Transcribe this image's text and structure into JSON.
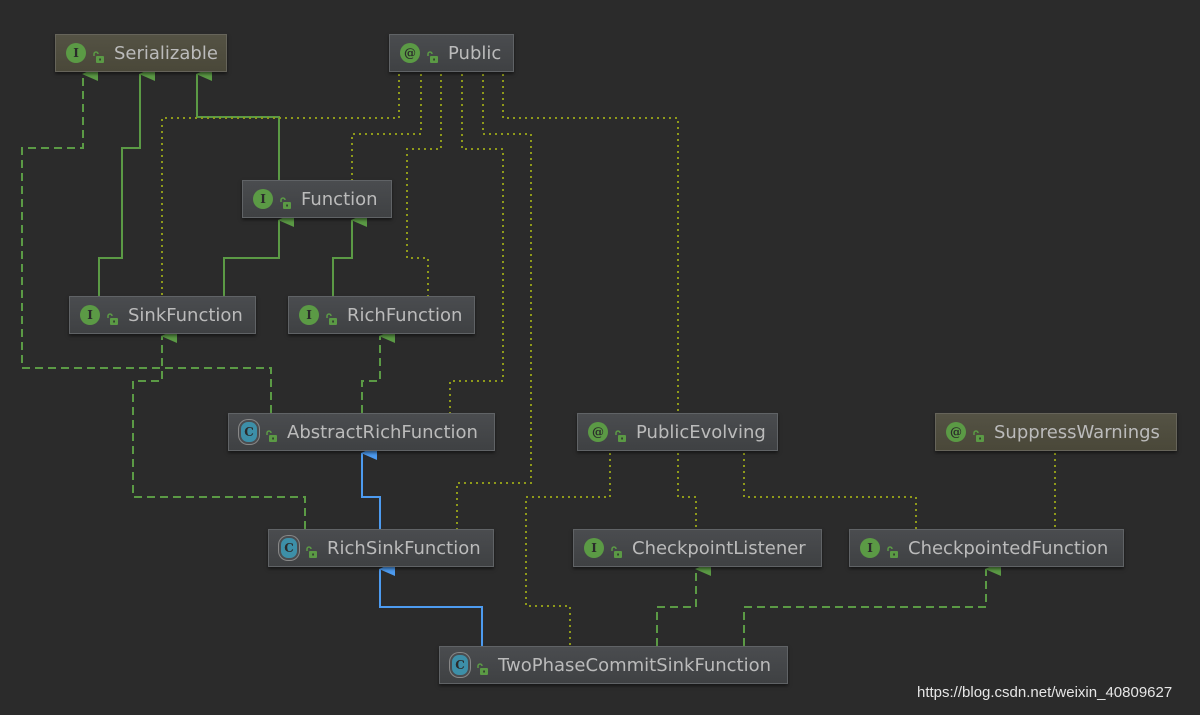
{
  "colors": {
    "background": "#2b2b2b",
    "interface_edge": "#5b9a45",
    "class_edge": "#4d9bf0",
    "annotation_edge": "#8f9a1a"
  },
  "nodes": [
    {
      "id": "serializable",
      "label": "Serializable",
      "kind": "interface",
      "kind_letter": "I"
    },
    {
      "id": "public",
      "label": "Public",
      "kind": "annotation",
      "kind_letter": "@"
    },
    {
      "id": "function",
      "label": "Function",
      "kind": "interface",
      "kind_letter": "I"
    },
    {
      "id": "sink",
      "label": "SinkFunction",
      "kind": "interface",
      "kind_letter": "I"
    },
    {
      "id": "rich",
      "label": "RichFunction",
      "kind": "interface",
      "kind_letter": "I"
    },
    {
      "id": "arf",
      "label": "AbstractRichFunction",
      "kind": "abstract-class",
      "kind_letter": "C"
    },
    {
      "id": "pe",
      "label": "PublicEvolving",
      "kind": "annotation",
      "kind_letter": "@"
    },
    {
      "id": "sw",
      "label": "SuppressWarnings",
      "kind": "annotation",
      "kind_letter": "@"
    },
    {
      "id": "rsf",
      "label": "RichSinkFunction",
      "kind": "abstract-class",
      "kind_letter": "C"
    },
    {
      "id": "cl",
      "label": "CheckpointListener",
      "kind": "interface",
      "kind_letter": "I"
    },
    {
      "id": "cf",
      "label": "CheckpointedFunction",
      "kind": "interface",
      "kind_letter": "I"
    },
    {
      "id": "tpc",
      "label": "TwoPhaseCommitSinkFunction",
      "kind": "abstract-class",
      "kind_letter": "C"
    }
  ],
  "watermark": "https://blog.csdn.net/weixin_40809627"
}
